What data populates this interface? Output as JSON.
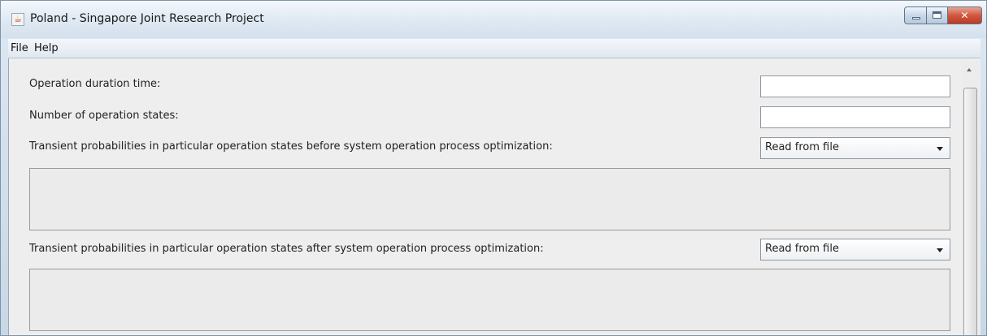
{
  "window": {
    "title": "Poland - Singapore Joint Research Project",
    "controls": {
      "minimize": "minimize-icon",
      "maximize": "maximize-icon",
      "close": "✕"
    }
  },
  "menu": {
    "file": "File",
    "help": "Help"
  },
  "form": {
    "duration": {
      "label": "Operation duration time:",
      "value": ""
    },
    "states": {
      "label": "Number of operation states:",
      "value": ""
    },
    "before": {
      "label": "Transient probabilities in particular operation states before system operation process optimization:",
      "select_value": "Read from file",
      "text": ""
    },
    "after": {
      "label": "Transient probabilities in particular operation states after system operation process optimization:",
      "select_value": "Read from file",
      "text": ""
    }
  },
  "colors": {
    "close_button": "#d2573f",
    "content_background": "#eeeeee"
  }
}
